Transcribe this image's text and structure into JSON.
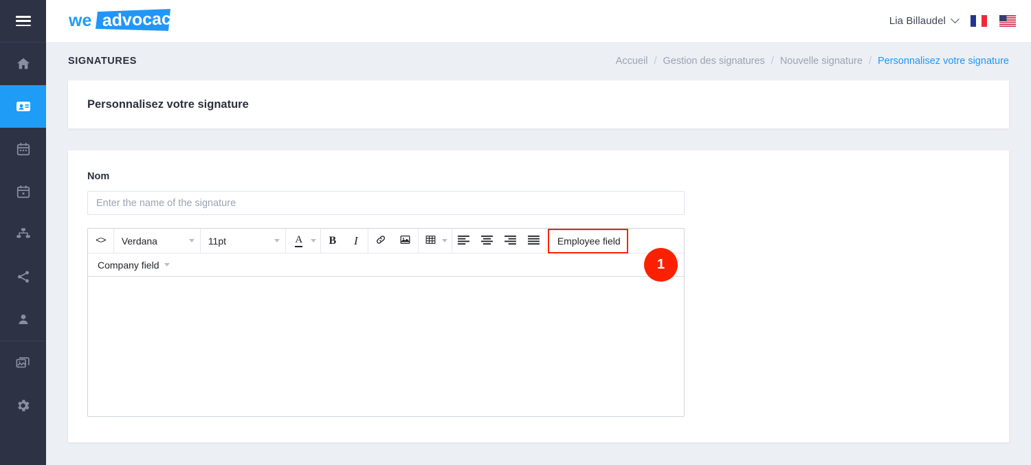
{
  "sidebar": {
    "menu_toggle": "menu-toggle",
    "items": [
      {
        "name": "home",
        "icon": "home-icon",
        "active": false
      },
      {
        "name": "signatures",
        "icon": "contact-card-icon",
        "active": true
      },
      {
        "name": "events",
        "icon": "calendar-events-icon",
        "active": false
      },
      {
        "name": "campaigns",
        "icon": "calendar-date-icon",
        "active": false
      },
      {
        "name": "banners",
        "icon": "network-icon",
        "active": false
      },
      {
        "name": "social",
        "icon": "share-icon",
        "active": false
      },
      {
        "name": "employees",
        "icon": "person-icon",
        "active": false
      },
      {
        "name": "media",
        "icon": "gallery-icon",
        "active": false
      },
      {
        "name": "settings",
        "icon": "gear-icon",
        "active": false
      }
    ]
  },
  "topbar": {
    "logo_we": "we",
    "logo_advocacy": "advocacy",
    "user_name": "Lia Billaudel",
    "flags": [
      "french-flag",
      "us-flag"
    ]
  },
  "page": {
    "title": "SIGNATURES",
    "breadcrumb": [
      {
        "label": "Accueil",
        "current": false
      },
      {
        "label": "Gestion des signatures",
        "current": false
      },
      {
        "label": "Nouvelle signature",
        "current": false
      },
      {
        "label": "Personnalisez votre signature",
        "current": true
      }
    ],
    "breadcrumb_separator": "/"
  },
  "title_card": {
    "heading": "Personnalisez votre signature"
  },
  "form": {
    "name_label": "Nom",
    "name_value": "",
    "name_placeholder": "Enter the name of the signature"
  },
  "editor": {
    "toolbar_row1": {
      "source_code": "<>",
      "font_family": "Verdana",
      "font_size": "11pt",
      "text_color": "A",
      "bold": "B",
      "italic": "I",
      "link": "link-icon",
      "image": "image-icon",
      "table": "table-icon",
      "align_left": "align-left-icon",
      "align_center": "align-center-icon",
      "align_right": "align-right-icon",
      "align_justify": "align-justify-icon",
      "employee_field": "Employee field"
    },
    "toolbar_row2": {
      "company_field": "Company field"
    },
    "body_content": ""
  },
  "annotation": {
    "badge_number": "1",
    "highlight_color": "#fb2100",
    "badge_color": "#fb2100"
  },
  "colors": {
    "accent": "#1f9cf5",
    "sidebar_bg": "#2e3245",
    "page_bg": "#eceff4",
    "link": "#2196f9"
  }
}
